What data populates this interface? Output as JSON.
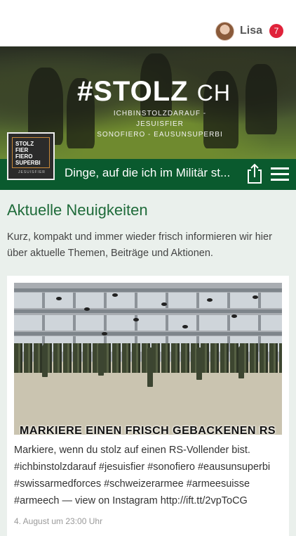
{
  "header": {
    "user_name": "Lisa",
    "notification_count": "7",
    "avatar_icon": "user-avatar"
  },
  "hero": {
    "title": "#STOLZ",
    "title_suffix": "CH",
    "subtitle_line1": "ICHBINSTOLZDARAUF - JESUISFIER",
    "subtitle_line2": "SONOFIERO - EAUSUNSUPERBI"
  },
  "logo": {
    "line1": "STOLZ",
    "line2": "FIER",
    "line3": "FIERO",
    "line4": "SUPERBI",
    "foot": "JESUISFIER"
  },
  "page_bar": {
    "title": "Dinge, auf die ich im Militär st...",
    "share_icon": "share-icon",
    "menu_icon": "hamburger-menu-icon",
    "color": "#0a5a2e"
  },
  "news": {
    "heading": "Aktuelle Neuigkeiten",
    "intro": "Kurz, kompakt und immer wieder frisch informieren wir hier über aktuelle Themen, Beiträge und Aktionen."
  },
  "post": {
    "image_caption": "MARKIERE EINEN FRISCH GEBACKENEN RS",
    "text": "Markiere, wenn du stolz auf einen RS-Vollender bist. #ichbinstolzdarauf #jesuisfier #sonofiero #eausunsuperbi #swissarmedforces #schweizerarmee #armeesuisse #armeech — view on Instagram http://ift.tt/2vpToCG",
    "date": "4. August um 23:00 Uhr"
  },
  "colors": {
    "accent_green": "#0a5a2e",
    "heading_green": "#1f6b3a",
    "badge_red": "#e0223a",
    "background": "#eaf0ec"
  }
}
